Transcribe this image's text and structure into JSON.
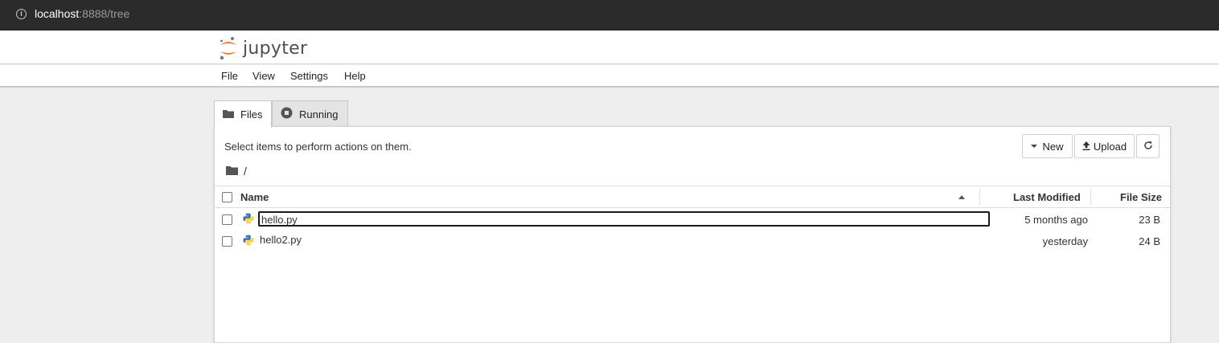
{
  "browser": {
    "url_host": "localhost",
    "url_rest": ":8888/tree"
  },
  "app": {
    "logo_text": "jupyter"
  },
  "menu": {
    "items": [
      "File",
      "View",
      "Settings",
      "Help"
    ]
  },
  "tabs": [
    {
      "label": "Files",
      "icon": "folder-icon",
      "active": true
    },
    {
      "label": "Running",
      "icon": "stop-circle-icon",
      "active": false
    }
  ],
  "toolbar": {
    "hint": "Select items to perform actions on them.",
    "new_label": "New",
    "upload_label": "Upload",
    "refresh_icon": "refresh-icon"
  },
  "breadcrumb": {
    "path": "/"
  },
  "table": {
    "columns": {
      "name": "Name",
      "modified": "Last Modified",
      "size": "File Size"
    },
    "sort": "name-ascending",
    "rows": [
      {
        "name": "hello.py",
        "modified": "5 months ago",
        "size": "23 B",
        "focused": true
      },
      {
        "name": "hello2.py",
        "modified": "yesterday",
        "size": "24 B",
        "focused": false
      }
    ]
  },
  "colors": {
    "jupyter_orange": "#F37726",
    "python_blue": "#3a75b0",
    "python_yellow": "#ffd43b"
  }
}
